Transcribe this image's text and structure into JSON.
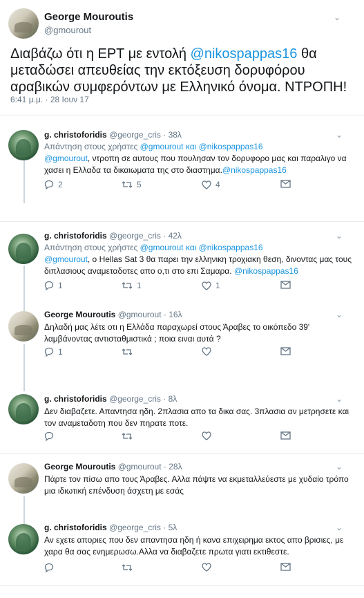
{
  "main_tweet": {
    "name": "George Mouroutis",
    "handle": "@gmourout",
    "text_pre": "Διαβάζω ότι η ΕΡΤ με εντολή ",
    "mention": "@nikospappas16",
    "text_post": "  θα μεταδώσει απευθείας την εκτόξευση δορυφόρου αραβικών συμφερόντων με Ελληνικό όνομα. ΝΤΡΟΠΗ!",
    "time": "6:41 μ.μ. · 28 Ιουν 17"
  },
  "replies": [
    {
      "name": "g. christoforidis",
      "handle": "@george_cris · 38λ",
      "reply_to_pre": "Απάντηση στους χρήστες ",
      "reply_to_users": "@gmourout και @nikospappas16",
      "text_mention_start": "@gmourout",
      "text": ", ντροπη σε αυτους που πουλησαν τον δορυφορο μας και παραλιγο να χασει η Ελλαδα τα δικαιωματα της στο διαστημα.",
      "text_mention_end": "@nikospappas16",
      "replies": "2",
      "retweets": "5",
      "likes": "4"
    },
    {
      "name": "g. christoforidis",
      "handle": "@george_cris · 42λ",
      "reply_to_pre": "Απάντηση στους χρήστες ",
      "reply_to_users": "@gmourout και @nikospappas16",
      "text_mention_start": "@gmourout",
      "text": ", ο Hellas Sat 3 θα παρει την ελληνικη τροχιακη θεση, δινοντας μας τους διπλασιους αναμεταδοτες απο ο,τι στο επι Σαμαρα. ",
      "text_mention_end": "@nikospappas16",
      "replies": "1",
      "retweets": "1",
      "likes": "1"
    },
    {
      "name": "George Mouroutis",
      "handle": "@gmourout · 16λ",
      "text": "Δηλαδή μας λέτε οτι η Ελλάδα παραχωρεί  στους Άραβες το οικόπεδο 39' λαμβάνοντας αντισταθμιστικά ; ποια ειναι αυτά ?",
      "replies": "1",
      "retweets": "",
      "likes": ""
    },
    {
      "name": "g. christoforidis",
      "handle": "@george_cris · 8λ",
      "text": "Δεν διαβαζετε. Απαντησα ηδη. 2πλασια απο τα δικα σας. 3πλασια αν μετρησετε και τον αναμεταδοτη που δεν πηρατε ποτε.",
      "replies": "",
      "retweets": "",
      "likes": ""
    },
    {
      "name": "George Mouroutis",
      "handle": "@gmourout · 28λ",
      "text": "Πάρτε τον πίσω απο τους Άραβες. Αλλα πάψτε να εκμεταλλεύεστε με χυδαίο τρόπο μια ιδιωτική επένδυση άσχετη με εσάς",
      "replies": "",
      "retweets": "",
      "likes": ""
    },
    {
      "name": "g. christoforidis",
      "handle": "@george_cris · 5λ",
      "text": "Αν εχετε αποριες που δεν απαντησα ηδη ή κανα επιχειρημα εκτος απο βρισιες, με χαρα θα σας ενημερωσω.Αλλα να διαβαζετε πρωτα γιατι εκτιθεστε.",
      "replies": "",
      "retweets": "",
      "likes": ""
    }
  ],
  "icons": [
    "chevron-down-icon",
    "reply-icon",
    "retweet-icon",
    "like-icon",
    "message-icon"
  ],
  "colors": {
    "accent": "#1b95e0",
    "muted": "#657786",
    "text": "#14171a"
  }
}
